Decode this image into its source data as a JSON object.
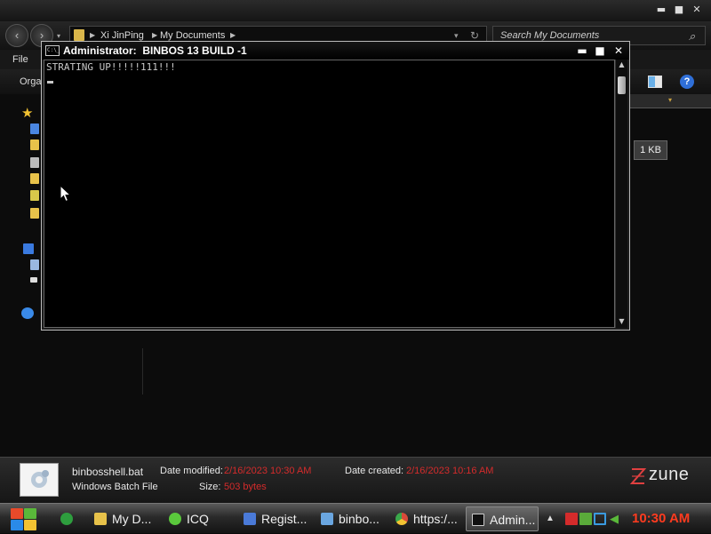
{
  "explorer": {
    "address": {
      "segments": [
        "Xi JinPing",
        "My Documents"
      ]
    },
    "search": {
      "placeholder": "Search My Documents"
    },
    "menu": {
      "file": "File"
    },
    "toolbar": {
      "organize": "Orga"
    },
    "file_size_column": "1 KB",
    "details": {
      "filename": "binbosshell.bat",
      "filetype": "Windows Batch File",
      "date_modified_label": "Date modified:",
      "date_modified": "2/16/2023 10:30 AM",
      "date_created_label": "Date created:",
      "date_created": "2/16/2023 10:16 AM",
      "size_label": "Size:",
      "size": "503 bytes",
      "brand": "zune"
    }
  },
  "cmd": {
    "title": "Administrator:  BINBOS 13 BUILD -1",
    "icon_text": "C:\\_",
    "output": "STRATING UP!!!!!111!!!"
  },
  "taskbar": {
    "tasks": [
      {
        "label": "",
        "icon": "notes-icon",
        "color": "#2e9e3e"
      },
      {
        "label": "My D...",
        "icon": "folder-icon",
        "color": "#e8c24a"
      },
      {
        "label": "ICQ",
        "icon": "icq-flower-icon",
        "color": "#5ac83c"
      },
      {
        "label": "Regist...",
        "icon": "registry-editor-icon",
        "color": "#4a7ad8"
      },
      {
        "label": "binbo...",
        "icon": "notepad-icon",
        "color": "#6aa6e0"
      },
      {
        "label": "https:/...",
        "icon": "chrome-icon",
        "color": "#d84a3a"
      },
      {
        "label": "Admin...",
        "icon": "cmd-icon",
        "color": "#222222"
      }
    ],
    "clock": "10:30 AM",
    "colors": {
      "clock": "#ff3b1f",
      "accent_red": "#d42b2b"
    }
  }
}
